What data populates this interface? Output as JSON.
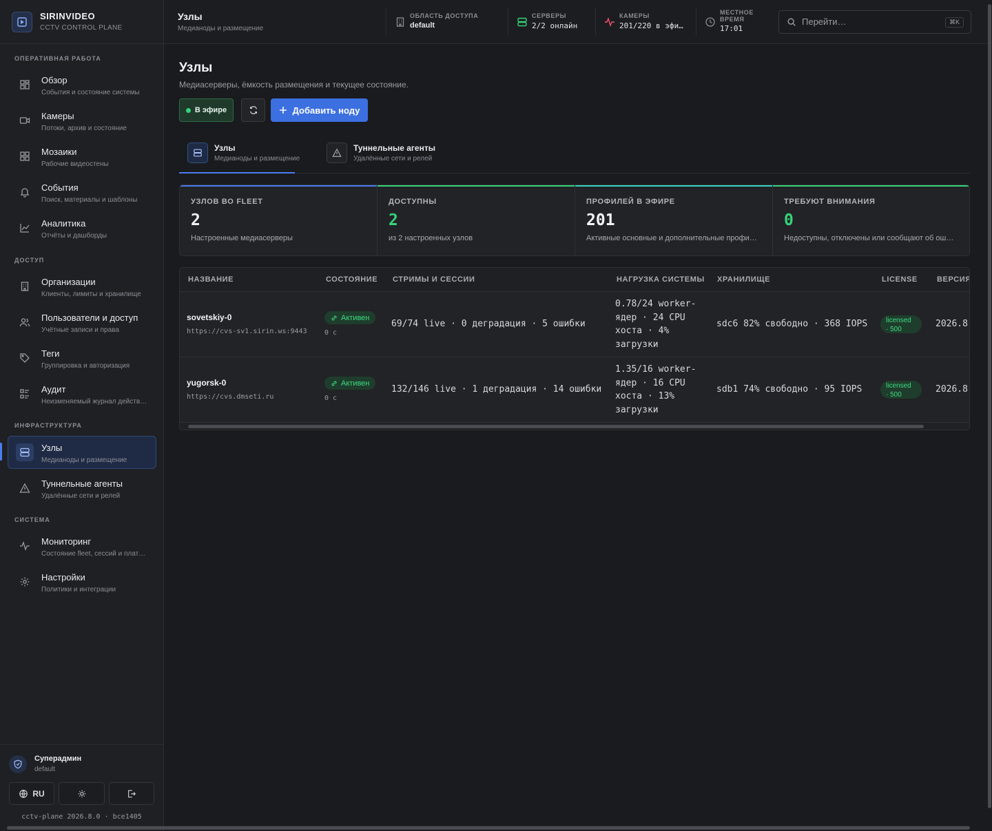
{
  "brand": {
    "name": "SIRINVIDEO",
    "subtitle": "CCTV CONTROL PLANE"
  },
  "sidebar": {
    "sections": [
      "ОПЕРАТИВНАЯ РАБОТА",
      "ДОСТУП",
      "ИНФРАСТРУКТУРА",
      "СИСТЕМА"
    ],
    "items": [
      {
        "label": "Обзор",
        "sub": "События и состояние системы",
        "icon": "dashboard-icon"
      },
      {
        "label": "Камеры",
        "sub": "Потоки, архив и состояние",
        "icon": "camera-icon"
      },
      {
        "label": "Мозаики",
        "sub": "Рабочие видеостены",
        "icon": "grid-icon"
      },
      {
        "label": "События",
        "sub": "Поиск, материалы и шаблоны",
        "icon": "bell-icon"
      },
      {
        "label": "Аналитика",
        "sub": "Отчёты и дашборды",
        "icon": "chart-icon"
      },
      {
        "label": "Организации",
        "sub": "Клиенты, лимиты и хранилище",
        "icon": "building-icon"
      },
      {
        "label": "Пользователи и доступ",
        "sub": "Учётные записи и права",
        "icon": "users-icon"
      },
      {
        "label": "Теги",
        "sub": "Группировка и авторизация",
        "icon": "tag-icon"
      },
      {
        "label": "Аудит",
        "sub": "Неизменяемый журнал действ…",
        "icon": "audit-icon"
      },
      {
        "label": "Узлы",
        "sub": "Медианоды и размещение",
        "icon": "server-icon"
      },
      {
        "label": "Туннельные агенты",
        "sub": "Удалённые сети и релей",
        "icon": "warning-icon"
      },
      {
        "label": "Мониторинг",
        "sub": "Состояние fleet, сессий и плат…",
        "icon": "pulse-icon"
      },
      {
        "label": "Настройки",
        "sub": "Политики и интеграции",
        "icon": "gear-icon"
      }
    ],
    "user": {
      "name": "Суперадмин",
      "role": "default",
      "lang": "RU"
    },
    "version": "cctv-plane 2026.8.0 · bce1405"
  },
  "topbar": {
    "title": "Узлы",
    "subtitle": "Медианоды и размещение",
    "scope": {
      "label": "ОБЛАСТЬ ДОСТУПА",
      "value": "default"
    },
    "servers": {
      "label": "СЕРВЕРЫ",
      "value": "2/2 онлайн"
    },
    "cameras": {
      "label": "КАМЕРЫ",
      "value": "201/220 в эфи…"
    },
    "time": {
      "label1": "МЕСТНОЕ",
      "label2": "ВРЕМЯ",
      "value": "17:01"
    },
    "search": {
      "placeholder": "Перейти…",
      "shortcut": "⌘K"
    }
  },
  "page": {
    "title": "Узлы",
    "subtitle": "Медиасерверы, ёмкость размещения и текущее состояние.",
    "live_label": "В эфире",
    "add_label": "Добавить ноду",
    "tabs": [
      {
        "label": "Узлы",
        "sub": "Медианоды и размещение"
      },
      {
        "label": "Туннельные агенты",
        "sub": "Удалённые сети и релей"
      }
    ]
  },
  "cards": [
    {
      "label": "УЗЛОВ ВО FLEET",
      "value": "2",
      "sub": "Настроенные медиасерверы",
      "color": "#4b7cf0"
    },
    {
      "label": "ДОСТУПНЫ",
      "value": "2",
      "sub": "из 2 настроенных узлов",
      "color": "#34d37a"
    },
    {
      "label": "ПРОФИЛЕЙ В ЭФИРЕ",
      "value": "201",
      "sub": "Активные основные и дополнительные профи…",
      "color": "#34d3c0"
    },
    {
      "label": "ТРЕБУЮТ ВНИМАНИЯ",
      "value": "0",
      "sub": "Недоступны, отключены или сообщают об ош…",
      "color": "#34d37a"
    }
  ],
  "table": {
    "columns": [
      "НАЗВАНИЕ",
      "СОСТОЯНИЕ",
      "СТРИМЫ И СЕССИИ",
      "НАГРУЗКА СИСТЕМЫ",
      "ХРАНИЛИЩЕ",
      "LICENSE",
      "ВЕРСИЯ"
    ],
    "rows": [
      {
        "name": "sovetskiy-0",
        "url": "https://cvs-sv1.sirin.ws:9443",
        "status": "Активен",
        "age": "0 с",
        "streams": "69/74 live · 0 деградация · 5 ошибки",
        "load": [
          "0.78/24 worker-",
          "ядер · 24 CPU",
          "хоста · 4%",
          "загрузки"
        ],
        "storage": "sdc6 82% свободно · 368 IOPS",
        "license": [
          "licensed",
          "· 500"
        ],
        "version": "2026.8"
      },
      {
        "name": "yugorsk-0",
        "url": "https://cvs.dmseti.ru",
        "status": "Активен",
        "age": "0 с",
        "streams": "132/146 live · 1 деградация · 14 ошибки",
        "load": [
          "1.35/16 worker-",
          "ядер · 16 CPU",
          "хоста · 13%",
          "загрузки"
        ],
        "storage": "sdb1 74% свободно · 95 IOPS",
        "license": [
          "licensed",
          "· 500"
        ],
        "version": "2026.8"
      }
    ]
  }
}
